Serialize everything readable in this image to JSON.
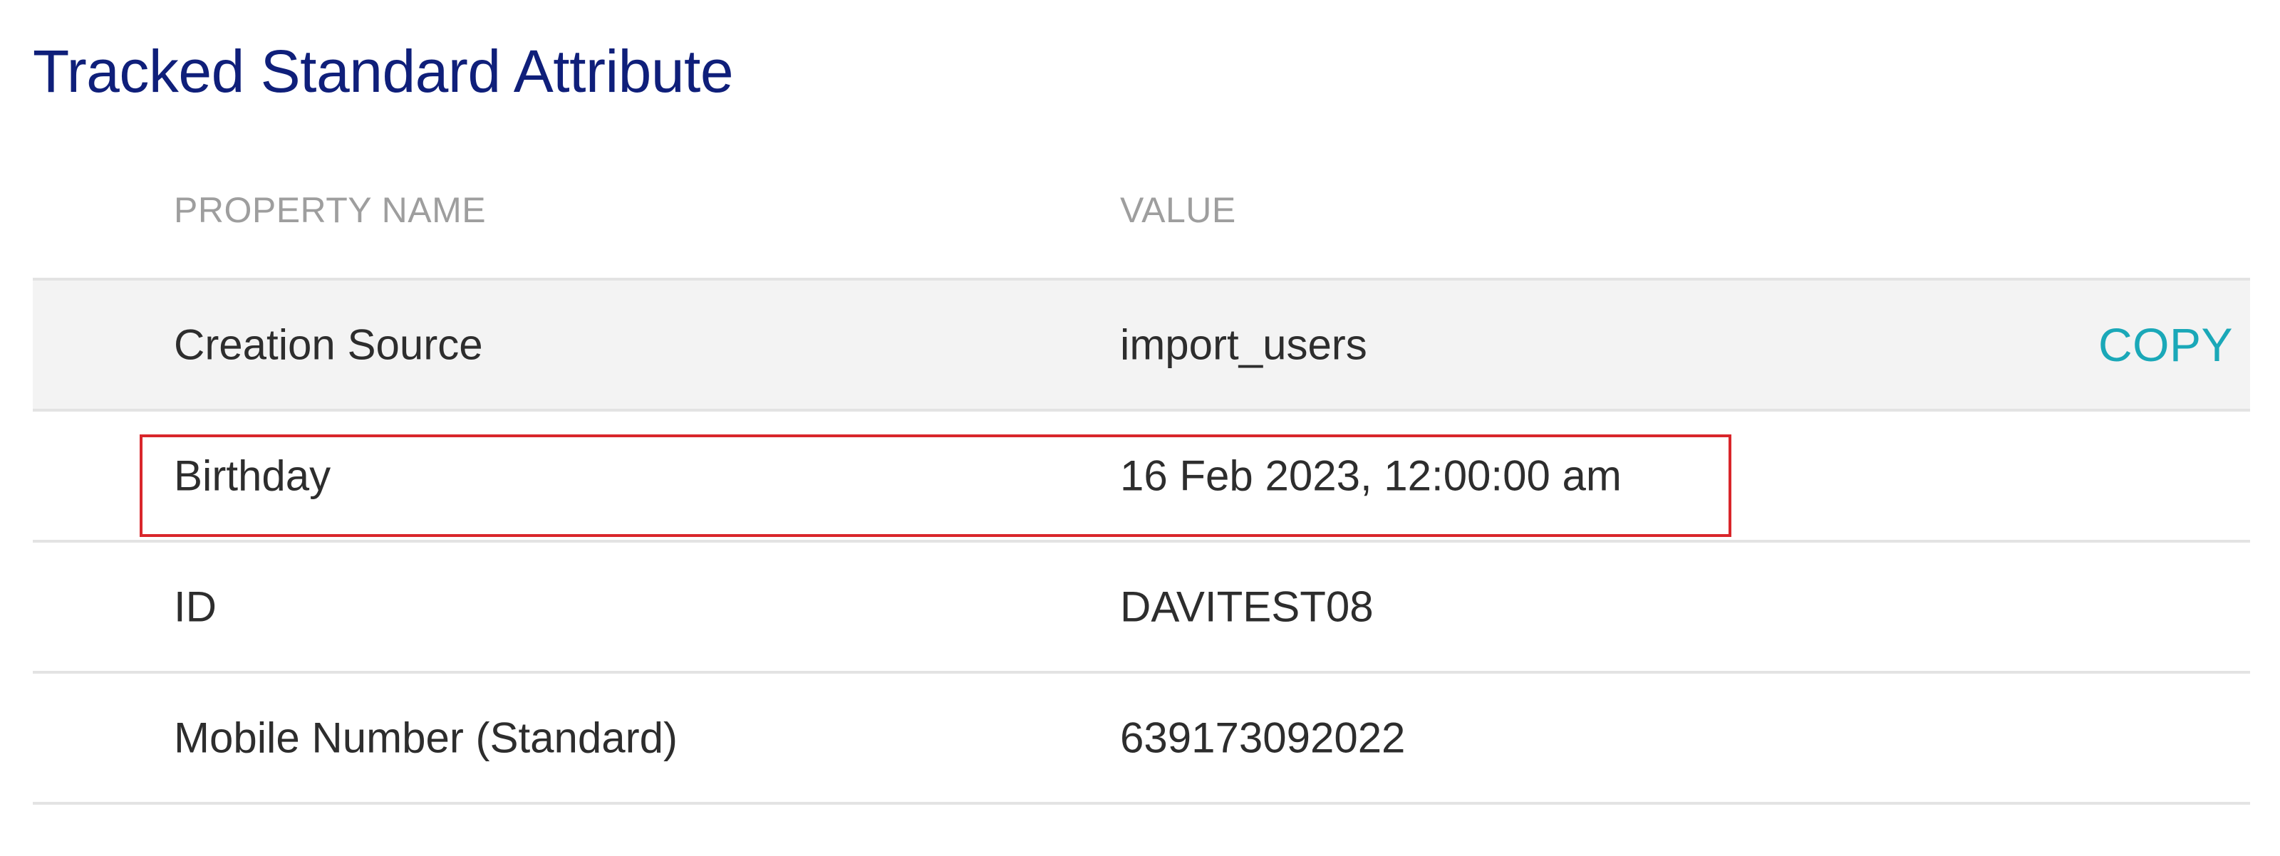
{
  "section": {
    "title": "Tracked Standard Attribute"
  },
  "table": {
    "headers": {
      "property_name": "PROPERTY NAME",
      "value": "VALUE"
    },
    "rows": [
      {
        "name": "Creation Source",
        "value": "import_users",
        "action": "COPY"
      },
      {
        "name": "Birthday",
        "value": "16 Feb 2023, 12:00:00 am"
      },
      {
        "name": "ID",
        "value": "DAVITEST08"
      },
      {
        "name": "Mobile Number (Standard)",
        "value": "639173092022"
      }
    ]
  },
  "colors": {
    "title": "#0f1f7a",
    "header_text": "#9e9e9e",
    "row_text": "#2d2d2d",
    "copy_accent": "#1aa8b8",
    "hover_row_bg": "#f3f3f3",
    "highlight_border": "#d9262b"
  }
}
